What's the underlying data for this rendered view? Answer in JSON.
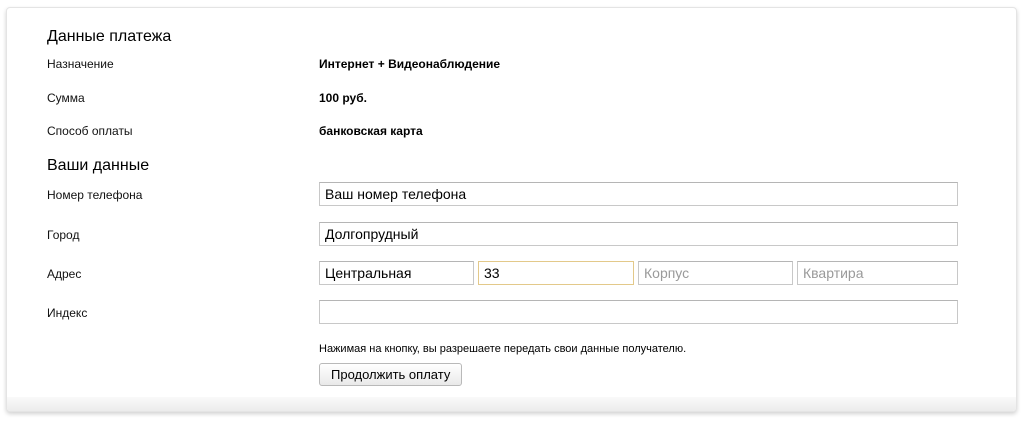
{
  "payment": {
    "title": "Данные платежа",
    "purpose_label": "Назначение",
    "purpose_value": "Интернет + Видеонаблюдение",
    "amount_label": "Сумма",
    "amount_value": "100 руб.",
    "method_label": "Способ оплаты",
    "method_value": "банковская карта"
  },
  "user": {
    "title": "Ваши данные",
    "phone_label": "Номер телефона",
    "phone_value": "Ваш номер телефона",
    "city_label": "Город",
    "city_value": "Долгопрудный",
    "address_label": "Адрес",
    "street_value": "Центральная",
    "house_value": "33",
    "building_placeholder": "Корпус",
    "apartment_placeholder": "Квартира",
    "index_label": "Индекс",
    "index_value": ""
  },
  "consent_note": "Нажимая на кнопку, вы разрешаете передать свои данные получателю.",
  "submit_label": "Продолжить оплату",
  "colors": {
    "focused_border": "#e3c98a",
    "field_border": "#c8c8c8"
  }
}
